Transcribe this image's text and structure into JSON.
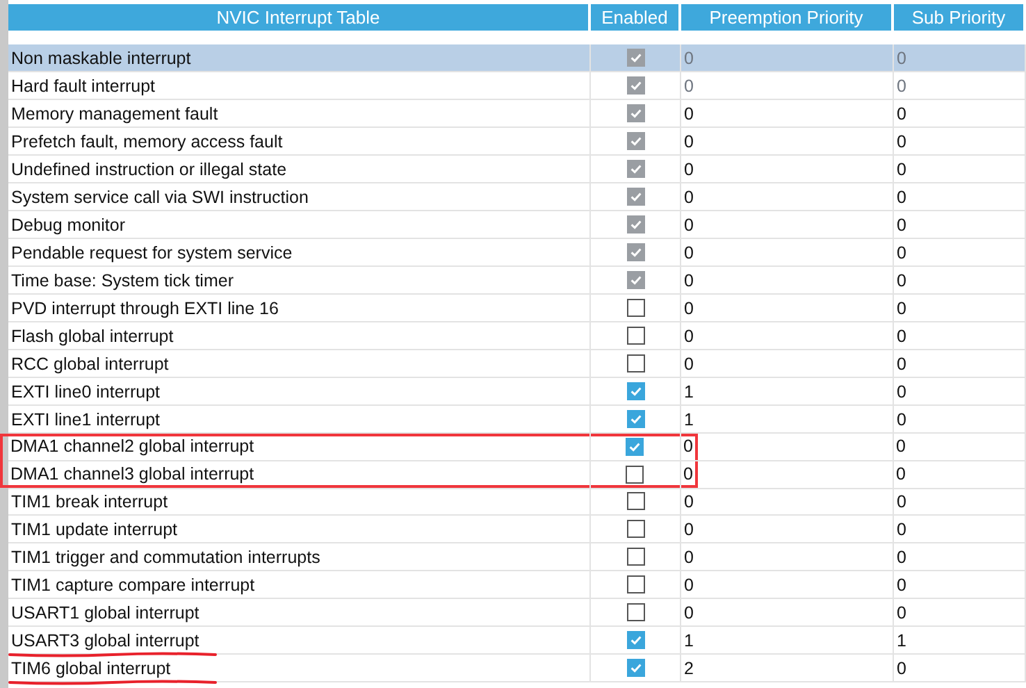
{
  "columns": [
    "NVIC Interrupt Table",
    "Enabled",
    "Preemption Priority",
    "Sub Priority"
  ],
  "rows": [
    {
      "name": "Non maskable interrupt",
      "enabled": true,
      "disabled": true,
      "preemption": "0",
      "sub": "0",
      "priority_disabled": true,
      "selected": true,
      "boxed": false,
      "underlined": false
    },
    {
      "name": "Hard fault interrupt",
      "enabled": true,
      "disabled": true,
      "preemption": "0",
      "sub": "0",
      "priority_disabled": true,
      "selected": false,
      "boxed": false,
      "underlined": false
    },
    {
      "name": "Memory management fault",
      "enabled": true,
      "disabled": true,
      "preemption": "0",
      "sub": "0",
      "priority_disabled": false,
      "selected": false,
      "boxed": false,
      "underlined": false
    },
    {
      "name": "Prefetch fault, memory access fault",
      "enabled": true,
      "disabled": true,
      "preemption": "0",
      "sub": "0",
      "priority_disabled": false,
      "selected": false,
      "boxed": false,
      "underlined": false
    },
    {
      "name": "Undefined instruction or illegal state",
      "enabled": true,
      "disabled": true,
      "preemption": "0",
      "sub": "0",
      "priority_disabled": false,
      "selected": false,
      "boxed": false,
      "underlined": false
    },
    {
      "name": "System service call via SWI instruction",
      "enabled": true,
      "disabled": true,
      "preemption": "0",
      "sub": "0",
      "priority_disabled": false,
      "selected": false,
      "boxed": false,
      "underlined": false
    },
    {
      "name": "Debug monitor",
      "enabled": true,
      "disabled": true,
      "preemption": "0",
      "sub": "0",
      "priority_disabled": false,
      "selected": false,
      "boxed": false,
      "underlined": false
    },
    {
      "name": "Pendable request for system service",
      "enabled": true,
      "disabled": true,
      "preemption": "0",
      "sub": "0",
      "priority_disabled": false,
      "selected": false,
      "boxed": false,
      "underlined": false
    },
    {
      "name": "Time base: System tick timer",
      "enabled": true,
      "disabled": true,
      "preemption": "0",
      "sub": "0",
      "priority_disabled": false,
      "selected": false,
      "boxed": false,
      "underlined": false
    },
    {
      "name": "PVD interrupt through EXTI line 16",
      "enabled": false,
      "disabled": false,
      "preemption": "0",
      "sub": "0",
      "priority_disabled": false,
      "selected": false,
      "boxed": false,
      "underlined": false
    },
    {
      "name": "Flash global interrupt",
      "enabled": false,
      "disabled": false,
      "preemption": "0",
      "sub": "0",
      "priority_disabled": false,
      "selected": false,
      "boxed": false,
      "underlined": false
    },
    {
      "name": "RCC global interrupt",
      "enabled": false,
      "disabled": false,
      "preemption": "0",
      "sub": "0",
      "priority_disabled": false,
      "selected": false,
      "boxed": false,
      "underlined": false
    },
    {
      "name": "EXTI line0 interrupt",
      "enabled": true,
      "disabled": false,
      "preemption": "1",
      "sub": "0",
      "priority_disabled": false,
      "selected": false,
      "boxed": false,
      "underlined": false
    },
    {
      "name": "EXTI line1 interrupt",
      "enabled": true,
      "disabled": false,
      "preemption": "1",
      "sub": "0",
      "priority_disabled": false,
      "selected": false,
      "boxed": false,
      "underlined": false
    },
    {
      "name": "DMA1 channel2 global interrupt",
      "enabled": true,
      "disabled": false,
      "preemption": "0",
      "sub": "0",
      "priority_disabled": false,
      "selected": false,
      "boxed": true,
      "underlined": false
    },
    {
      "name": "DMA1 channel3 global interrupt",
      "enabled": false,
      "disabled": false,
      "preemption": "0",
      "sub": "0",
      "priority_disabled": false,
      "selected": false,
      "boxed": true,
      "underlined": false
    },
    {
      "name": "TIM1 break interrupt",
      "enabled": false,
      "disabled": false,
      "preemption": "0",
      "sub": "0",
      "priority_disabled": false,
      "selected": false,
      "boxed": false,
      "underlined": false
    },
    {
      "name": "TIM1 update interrupt",
      "enabled": false,
      "disabled": false,
      "preemption": "0",
      "sub": "0",
      "priority_disabled": false,
      "selected": false,
      "boxed": false,
      "underlined": false
    },
    {
      "name": "TIM1 trigger and commutation interrupts",
      "enabled": false,
      "disabled": false,
      "preemption": "0",
      "sub": "0",
      "priority_disabled": false,
      "selected": false,
      "boxed": false,
      "underlined": false
    },
    {
      "name": "TIM1 capture compare interrupt",
      "enabled": false,
      "disabled": false,
      "preemption": "0",
      "sub": "0",
      "priority_disabled": false,
      "selected": false,
      "boxed": false,
      "underlined": false
    },
    {
      "name": "USART1 global interrupt",
      "enabled": false,
      "disabled": false,
      "preemption": "0",
      "sub": "0",
      "priority_disabled": false,
      "selected": false,
      "boxed": false,
      "underlined": false
    },
    {
      "name": "USART3 global interrupt",
      "enabled": true,
      "disabled": false,
      "preemption": "1",
      "sub": "1",
      "priority_disabled": false,
      "selected": false,
      "boxed": false,
      "underlined": true
    },
    {
      "name": "TIM6 global interrupt",
      "enabled": true,
      "disabled": false,
      "preemption": "2",
      "sub": "0",
      "priority_disabled": false,
      "selected": false,
      "boxed": false,
      "underlined": true
    }
  ]
}
